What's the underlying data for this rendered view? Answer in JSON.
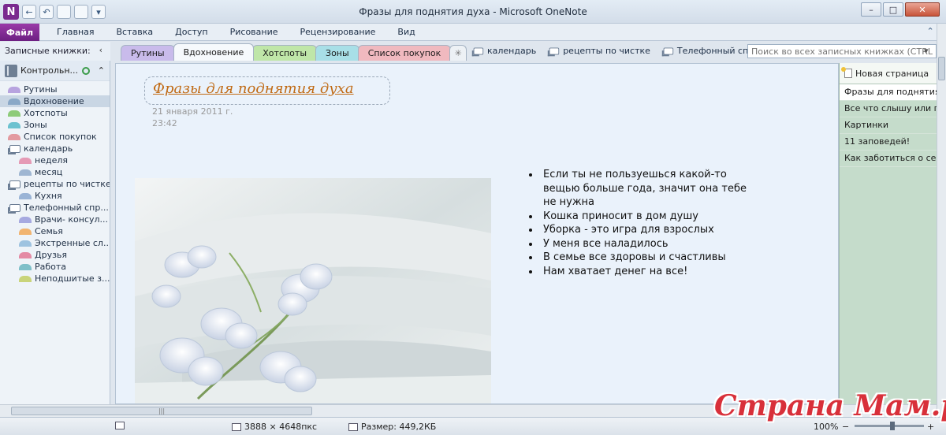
{
  "window": {
    "title": "Фразы для поднятия духа  -  Microsoft OneNote",
    "controls": {
      "minimize": "–",
      "maximize": "□",
      "close": "✕"
    }
  },
  "quick_access": {
    "app_glyph": "N",
    "back": "←",
    "undo": "↶",
    "dropdown": "▾"
  },
  "ribbon": {
    "file": "Файл",
    "tabs": [
      "Главная",
      "Вставка",
      "Доступ",
      "Рисование",
      "Рецензирование",
      "Вид"
    ],
    "help": "⌃ ?"
  },
  "notebook_nav": {
    "header": "Записные книжки:",
    "collapse": "‹",
    "notebook": "Контрольн...",
    "notebook_expand": "⌃",
    "items": [
      {
        "label": "Рутины",
        "type": "section",
        "indent": 0,
        "color": "#b7a3df"
      },
      {
        "label": "Вдохновение",
        "type": "section",
        "indent": 0,
        "color": "#8aa8c7",
        "selected": true
      },
      {
        "label": "Хотспоты",
        "type": "section",
        "indent": 0,
        "color": "#8dcb79"
      },
      {
        "label": "Зоны",
        "type": "section",
        "indent": 0,
        "color": "#6cc2d0"
      },
      {
        "label": "Список покупок",
        "type": "section",
        "indent": 0,
        "color": "#e39aa0"
      },
      {
        "label": "календарь",
        "type": "group",
        "indent": 0
      },
      {
        "label": "неделя",
        "type": "section",
        "indent": 1,
        "color": "#e59ab5"
      },
      {
        "label": "месяц",
        "type": "section",
        "indent": 1,
        "color": "#9fb6d2"
      },
      {
        "label": "рецепты по чистке",
        "type": "group",
        "indent": 0
      },
      {
        "label": "Кухня",
        "type": "section",
        "indent": 1,
        "color": "#9ab4d6"
      },
      {
        "label": "Телефонный спр...",
        "type": "group",
        "indent": 0
      },
      {
        "label": "Врачи- консул...",
        "type": "section",
        "indent": 1,
        "color": "#a6a9e0"
      },
      {
        "label": "Семья",
        "type": "section",
        "indent": 1,
        "color": "#f1b470"
      },
      {
        "label": "Экстренные сл...",
        "type": "section",
        "indent": 1,
        "color": "#9ec3e0"
      },
      {
        "label": "Друзья",
        "type": "section",
        "indent": 1,
        "color": "#e48aa4"
      },
      {
        "label": "Работа",
        "type": "section",
        "indent": 1,
        "color": "#7ec0c9"
      },
      {
        "label": "Неподшитые з...",
        "type": "section",
        "indent": 1,
        "color": "#c9d47a"
      }
    ]
  },
  "section_tabs": [
    {
      "label": "Рутины",
      "color": "#c9bbeb"
    },
    {
      "label": "Вдохновение",
      "color": "#f6f9fc",
      "active": true
    },
    {
      "label": "Хотспоты",
      "color": "#bfe6a8"
    },
    {
      "label": "Зоны",
      "color": "#a8dfe7"
    },
    {
      "label": "Список покупок",
      "color": "#f0b9bf"
    }
  ],
  "section_add_glyph": "✳",
  "group_links": [
    "календарь",
    "рецепты по чистке",
    "Телефонный справ..."
  ],
  "search": {
    "placeholder": "Поиск во всех записных книжках (CTRL+E)",
    "button": "▾"
  },
  "page": {
    "title": "Фразы для поднятия духа",
    "date": "21 января 2011 г.",
    "time": "23:42",
    "bullets": [
      "Если ты не пользуешься какой-то вещью больше года, значит она тебе не нужна",
      "Кошка приносит в дом душу",
      "Уборка - это игра для взрослых",
      "У меня все наладилось",
      "В семье все здоровы и счастливы",
      "Нам хватает денег на все!"
    ]
  },
  "page_list": {
    "new_page": "Новая страница",
    "new_page_dropdown": "▾",
    "items": [
      {
        "label": "Фразы для поднятия ду",
        "selected": true
      },
      {
        "label": "Все что слышу или го"
      },
      {
        "label": "Картинки"
      },
      {
        "label": "11 заповедей!"
      },
      {
        "label": "Как заботиться о себе"
      }
    ]
  },
  "hscroll_grip": "|||",
  "status": {
    "dimensions": "3888 × 4648пкс",
    "size": "Размер: 449,2КБ",
    "zoom": "100%",
    "zoom_minus": "−",
    "zoom_plus": "+",
    "zoom_level": 0.55
  },
  "watermark": "Страна Мам.ру"
}
